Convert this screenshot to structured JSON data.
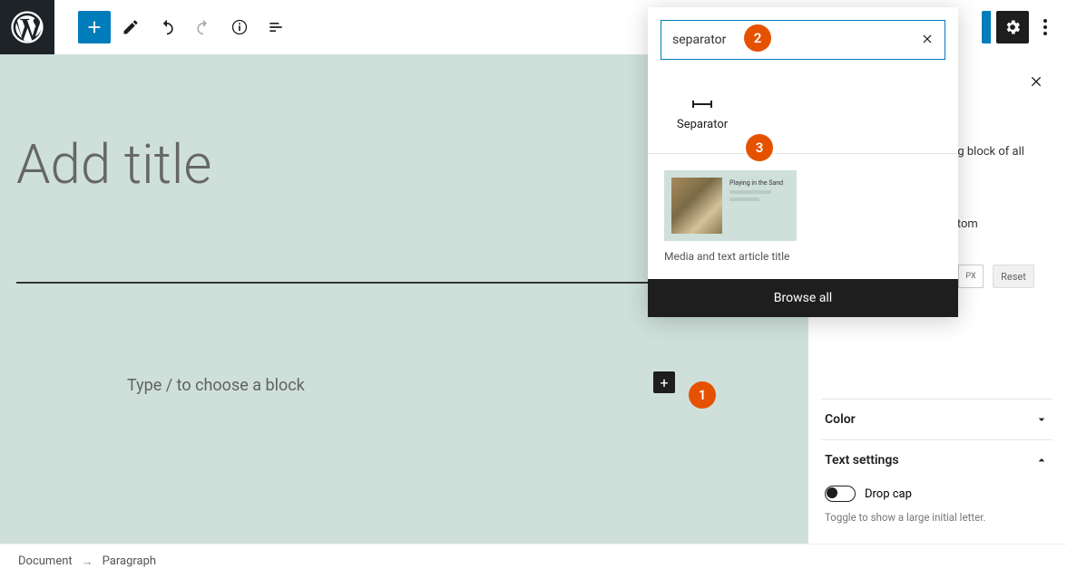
{
  "toolbar": {
    "add": "+"
  },
  "editor": {
    "title_placeholder": "Add title",
    "block_placeholder": "Type / to choose a block",
    "inline_add": "+"
  },
  "popover": {
    "search_value": "separator",
    "result_label": "Separator",
    "pattern_title": "Playing in the Sand",
    "pattern_label": "Media and text article title",
    "browse_all": "Browse all"
  },
  "sidebar": {
    "frag1": "ing block of all",
    "frag2": "istom",
    "px": "PX",
    "reset": "Reset",
    "color": "Color",
    "text_settings": "Text settings",
    "dropcap": "Drop cap",
    "dropcap_hint": "Toggle to show a large initial letter."
  },
  "footer": {
    "document": "Document",
    "paragraph": "Paragraph"
  },
  "annotations": {
    "a1": "1",
    "a2": "2",
    "a3": "3"
  }
}
